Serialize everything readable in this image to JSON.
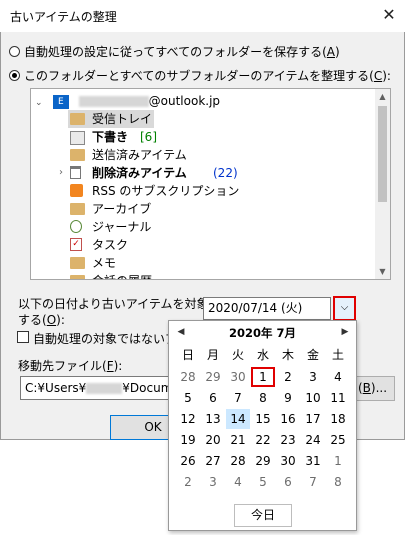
{
  "dialog": {
    "title": "古いアイテムの整理",
    "close_glyph": "✕",
    "option_all_pre": "自動処理の設定に従ってすべてのフォルダーを保存する(",
    "option_all_key": "A",
    "option_all_post": ")",
    "option_this_pre": "このフォルダーとすべてのサブフォルダーのアイテムを整理する(",
    "option_this_key": "C",
    "option_this_post": "):",
    "account_suffix": "@outlook.jp",
    "folders": [
      {
        "label": "受信トレイ",
        "count": ""
      },
      {
        "label": "下書き",
        "count": "[6]"
      },
      {
        "label": "送信済みアイテム",
        "count": ""
      },
      {
        "label": "削除済みアイテム",
        "count": "(22)"
      },
      {
        "label": "RSS のサブスクリプション",
        "count": ""
      },
      {
        "label": "アーカイブ",
        "count": ""
      },
      {
        "label": "ジャーナル",
        "count": ""
      },
      {
        "label": "タスク",
        "count": ""
      },
      {
        "label": "メモ",
        "count": ""
      },
      {
        "label": "会話の履歴",
        "count": ""
      }
    ],
    "older_label_line1": "以下の日付より古いアイテムを対象と",
    "older_label_line2_pre": "する(",
    "older_label_line2_key": "O",
    "older_label_line2_post": "):",
    "date_value": "2020/07/14 (火)",
    "dropdown_glyph": "⌵",
    "exclude_label": "自動処理の対象ではないアイ",
    "move_label_pre": "移動先ファイル(",
    "move_label_key": "F",
    "move_label_post": "):",
    "path_prefix": "C:¥Users¥",
    "path_suffix": "¥Docume",
    "browse_label_pre": "(",
    "browse_label_key": "B",
    "browse_label_post": ")...",
    "ok_label": "OK"
  },
  "calendar": {
    "header": "2020年 7月",
    "prev_glyph": "◀",
    "next_glyph": "▶",
    "weekdays": [
      "日",
      "月",
      "火",
      "水",
      "木",
      "金",
      "土"
    ],
    "weeks": [
      [
        "28",
        "29",
        "30",
        "1",
        "2",
        "3",
        "4"
      ],
      [
        "5",
        "6",
        "7",
        "8",
        "9",
        "10",
        "11"
      ],
      [
        "12",
        "13",
        "14",
        "15",
        "16",
        "17",
        "18"
      ],
      [
        "19",
        "20",
        "21",
        "22",
        "23",
        "24",
        "25"
      ],
      [
        "26",
        "27",
        "28",
        "29",
        "30",
        "31",
        "1"
      ],
      [
        "2",
        "3",
        "4",
        "5",
        "6",
        "7",
        "8"
      ]
    ],
    "selected_day": "14",
    "marked_day": "1",
    "today_button": "今日"
  },
  "colors": {
    "highlight_red": "#e00000",
    "count_green": "#008000",
    "count_blue": "#0033cc",
    "today_fill": "#cce8ff"
  }
}
